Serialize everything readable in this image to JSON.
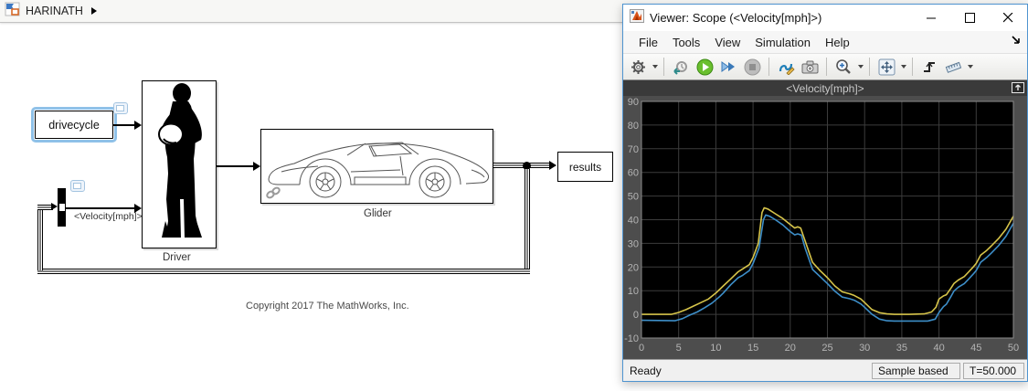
{
  "editor": {
    "breadcrumb": {
      "model_name": "HARINATH"
    },
    "blocks": {
      "drivecycle": {
        "label": "drivecycle"
      },
      "driver": {
        "label": "Driver"
      },
      "glider": {
        "label": "Glider"
      },
      "results": {
        "label": "results"
      },
      "velocity_tag": {
        "label": "<Velocity[mph]>"
      }
    },
    "copyright": "Copyright 2017 The MathWorks, Inc."
  },
  "scope": {
    "window_title": "Viewer: Scope (<Velocity[mph]>)",
    "menus": [
      "File",
      "Tools",
      "View",
      "Simulation",
      "Help"
    ],
    "toolbar_icons": [
      "settings-gear",
      "step-back",
      "run",
      "step-forward",
      "stop",
      "signal-selector",
      "snapshot-camera",
      "zoom-in",
      "pan-fit",
      "trigger",
      "measurements-ruler"
    ],
    "plot_title": "<Velocity[mph]>",
    "status": {
      "left": "Ready",
      "sample_mode": "Sample based",
      "time": "T=50.000"
    }
  },
  "chart_data": {
    "type": "line",
    "title": "<Velocity[mph]>",
    "xlabel": "",
    "ylabel": "",
    "xlim": [
      0,
      50
    ],
    "ylim": [
      -10,
      90
    ],
    "xticks": [
      0,
      5,
      10,
      15,
      20,
      25,
      30,
      35,
      40,
      45,
      50
    ],
    "yticks": [
      -10,
      0,
      10,
      20,
      30,
      40,
      50,
      60,
      70,
      80,
      90
    ],
    "grid": true,
    "legend": "none",
    "background": "#000000",
    "grid_color": "#3c3c3c",
    "series": [
      {
        "name": "yellow-signal",
        "color": "#d6c44a",
        "points": [
          [
            0,
            0
          ],
          [
            4,
            0
          ],
          [
            5,
            0.8
          ],
          [
            6,
            2
          ],
          [
            7,
            3.5
          ],
          [
            8,
            5
          ],
          [
            9,
            6.5
          ],
          [
            10,
            9
          ],
          [
            11,
            12
          ],
          [
            12,
            15
          ],
          [
            13,
            18
          ],
          [
            13.5,
            19
          ],
          [
            14.5,
            21
          ],
          [
            15,
            24
          ],
          [
            15.7,
            30
          ],
          [
            16.2,
            43
          ],
          [
            16.5,
            45
          ],
          [
            17,
            44.5
          ],
          [
            18,
            42.5
          ],
          [
            19,
            40.5
          ],
          [
            20,
            38
          ],
          [
            20.6,
            36.5
          ],
          [
            21,
            37
          ],
          [
            21.4,
            36.5
          ],
          [
            22,
            31
          ],
          [
            23,
            22
          ],
          [
            24,
            18.5
          ],
          [
            25,
            15.5
          ],
          [
            26,
            12
          ],
          [
            27,
            9.5
          ],
          [
            28,
            8.7
          ],
          [
            28.6,
            8
          ],
          [
            29.5,
            6.5
          ],
          [
            30,
            5
          ],
          [
            31,
            2
          ],
          [
            32,
            0.7
          ],
          [
            33,
            0.2
          ],
          [
            34,
            0
          ],
          [
            36,
            0
          ],
          [
            38,
            0.2
          ],
          [
            39,
            1
          ],
          [
            39.6,
            3
          ],
          [
            40,
            6.5
          ],
          [
            40.6,
            7.8
          ],
          [
            41,
            8.3
          ],
          [
            41.6,
            11
          ],
          [
            42,
            13
          ],
          [
            42.6,
            14.5
          ],
          [
            43.4,
            16
          ],
          [
            44,
            18
          ],
          [
            44.6,
            20
          ],
          [
            45,
            21.5
          ],
          [
            45.6,
            25
          ],
          [
            46.4,
            27
          ],
          [
            47,
            28.8
          ],
          [
            48,
            32
          ],
          [
            49,
            36
          ],
          [
            50,
            41.5
          ]
        ]
      },
      {
        "name": "blue-signal",
        "color": "#3d8ec8",
        "points": [
          [
            0,
            -2.5
          ],
          [
            4.5,
            -2.7
          ],
          [
            5.5,
            -1.8
          ],
          [
            6.5,
            -0.3
          ],
          [
            7.5,
            1
          ],
          [
            8.5,
            2.8
          ],
          [
            9.5,
            4.8
          ],
          [
            10.5,
            7.5
          ],
          [
            11,
            9
          ],
          [
            12,
            12.5
          ],
          [
            13,
            15.5
          ],
          [
            13.6,
            16.5
          ],
          [
            14.5,
            18.5
          ],
          [
            15,
            21.5
          ],
          [
            15.8,
            28
          ],
          [
            16.4,
            40
          ],
          [
            16.7,
            42
          ],
          [
            17.2,
            41.5
          ],
          [
            18,
            40
          ],
          [
            19,
            37.8
          ],
          [
            20,
            35
          ],
          [
            20.6,
            33.6
          ],
          [
            21,
            34
          ],
          [
            21.5,
            33.5
          ],
          [
            22,
            28
          ],
          [
            23,
            19
          ],
          [
            24,
            16
          ],
          [
            25,
            13
          ],
          [
            26,
            9.8
          ],
          [
            27,
            7.3
          ],
          [
            28,
            6.6
          ],
          [
            28.6,
            6
          ],
          [
            29.5,
            4.4
          ],
          [
            30,
            3
          ],
          [
            31,
            0
          ],
          [
            32,
            -2
          ],
          [
            33,
            -2.7
          ],
          [
            34,
            -2.8
          ],
          [
            36,
            -2.8
          ],
          [
            38.5,
            -2.8
          ],
          [
            39.5,
            -2
          ],
          [
            40,
            0.8
          ],
          [
            40.6,
            3.3
          ],
          [
            41,
            4.3
          ],
          [
            41.6,
            7.5
          ],
          [
            42,
            9.8
          ],
          [
            42.6,
            11.5
          ],
          [
            43.4,
            13
          ],
          [
            44,
            15
          ],
          [
            44.6,
            17
          ],
          [
            45,
            18.5
          ],
          [
            45.6,
            22
          ],
          [
            46.4,
            24
          ],
          [
            47,
            25.8
          ],
          [
            48,
            29
          ],
          [
            49,
            33
          ],
          [
            50,
            38.5
          ]
        ]
      }
    ]
  }
}
